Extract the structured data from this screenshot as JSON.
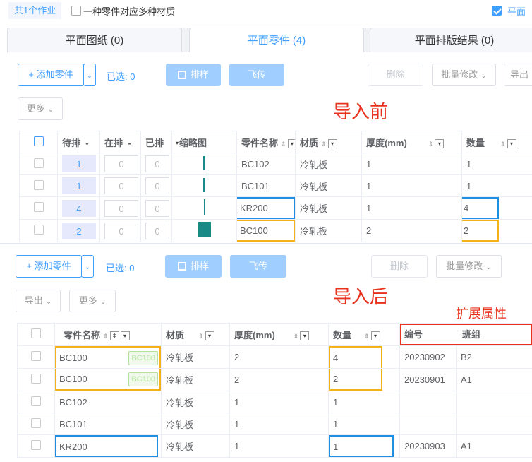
{
  "topbar": {
    "count_tag": "共1个作业",
    "multi_material_label": "一种零件对应多种材质",
    "plane_label": "平面"
  },
  "tabs": [
    {
      "label": "平面图纸 (0)"
    },
    {
      "label": "平面零件 (4)"
    },
    {
      "label": "平面排版结果 (0)"
    }
  ],
  "toolbar": {
    "add_part": "+ 添加零件",
    "selected": "已选: 0",
    "layout": "排样",
    "fly": "飞传",
    "delete": "删除",
    "batch_edit": "批量修改",
    "export": "导出",
    "more": "更多"
  },
  "annotations": {
    "before": "导入前",
    "after": "导入后",
    "ext_attr": "扩展属性"
  },
  "table_before": {
    "headers": [
      "待排",
      "在排",
      "已排",
      "缩略图",
      "零件名称",
      "材质",
      "厚度(mm)",
      "数量"
    ],
    "rows": [
      {
        "pending": "1",
        "inproc": "0",
        "done": "0",
        "name": "BC102",
        "material": "冷轧板",
        "thickness": "1",
        "qty": "1"
      },
      {
        "pending": "1",
        "inproc": "0",
        "done": "0",
        "name": "BC101",
        "material": "冷轧板",
        "thickness": "1",
        "qty": "1"
      },
      {
        "pending": "4",
        "inproc": "0",
        "done": "0",
        "name": "KR200",
        "material": "冷轧板",
        "thickness": "1",
        "qty": "4"
      },
      {
        "pending": "2",
        "inproc": "0",
        "done": "0",
        "name": "BC100",
        "material": "冷轧板",
        "thickness": "2",
        "qty": "2"
      }
    ]
  },
  "table_after": {
    "headers": [
      "零件名称",
      "材质",
      "厚度(mm)",
      "数量",
      "编号",
      "班组"
    ],
    "rows": [
      {
        "name": "BC100",
        "badge": "BC100",
        "material": "冷轧板",
        "thickness": "2",
        "qty": "4",
        "code": "20230902",
        "team": "B2"
      },
      {
        "name": "BC100",
        "badge": "BC100",
        "material": "冷轧板",
        "thickness": "2",
        "qty": "2",
        "code": "20230901",
        "team": "A1"
      },
      {
        "name": "BC102",
        "badge": "",
        "material": "冷轧板",
        "thickness": "1",
        "qty": "1",
        "code": "",
        "team": ""
      },
      {
        "name": "BC101",
        "badge": "",
        "material": "冷轧板",
        "thickness": "1",
        "qty": "1",
        "code": "",
        "team": ""
      },
      {
        "name": "KR200",
        "badge": "",
        "material": "冷轧板",
        "thickness": "1",
        "qty": "1",
        "code": "20230903",
        "team": "A1"
      }
    ]
  },
  "colors": {
    "accent": "#409eff",
    "highlight_blue": "#1e8fe1",
    "highlight_yellow": "#f3b21a",
    "annotation_red": "#e8321e",
    "thumb_teal": "#1a8a86"
  }
}
